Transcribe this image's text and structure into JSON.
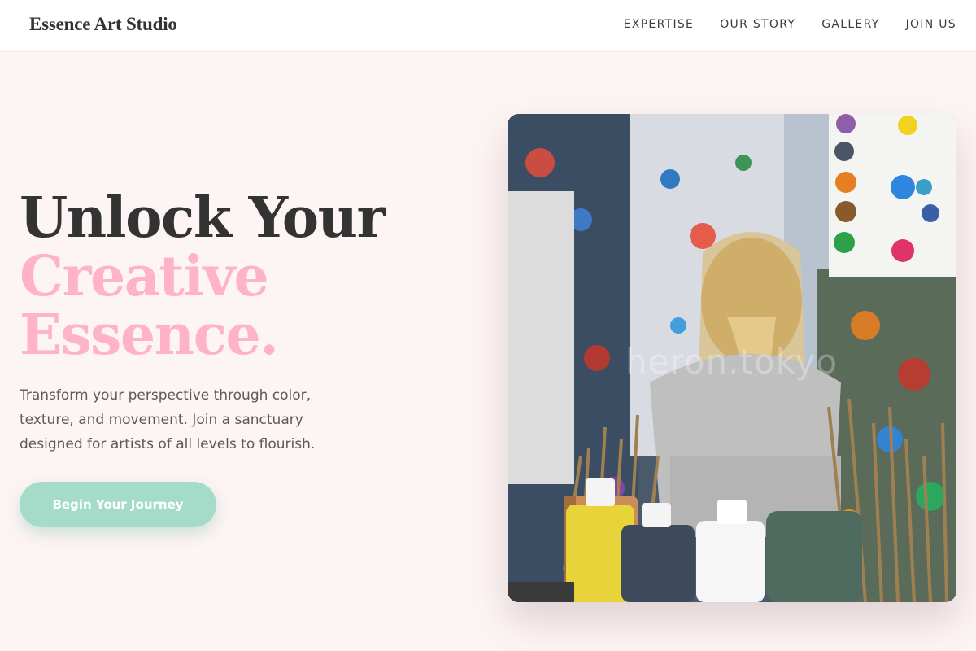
{
  "brand": {
    "name": "Essence Art Studio"
  },
  "nav": {
    "items": [
      {
        "label": "EXPERTISE"
      },
      {
        "label": "OUR STORY"
      },
      {
        "label": "GALLERY"
      },
      {
        "label": "JOIN US"
      }
    ]
  },
  "hero": {
    "title_line1": "Unlock Your",
    "title_accent_line1": "Creative",
    "title_accent_line2": "Essence.",
    "description": "Transform your perspective through color, texture, and movement. Join a sanctuary designed for artists of all levels to flourish.",
    "cta_label": "Begin Your Journey",
    "image_watermark": "heron.tokyo"
  },
  "colors": {
    "accent_pink": "#ffb3c6",
    "accent_mint": "#a5dcc9",
    "background": "#fdf4f4",
    "heading": "#333333"
  }
}
